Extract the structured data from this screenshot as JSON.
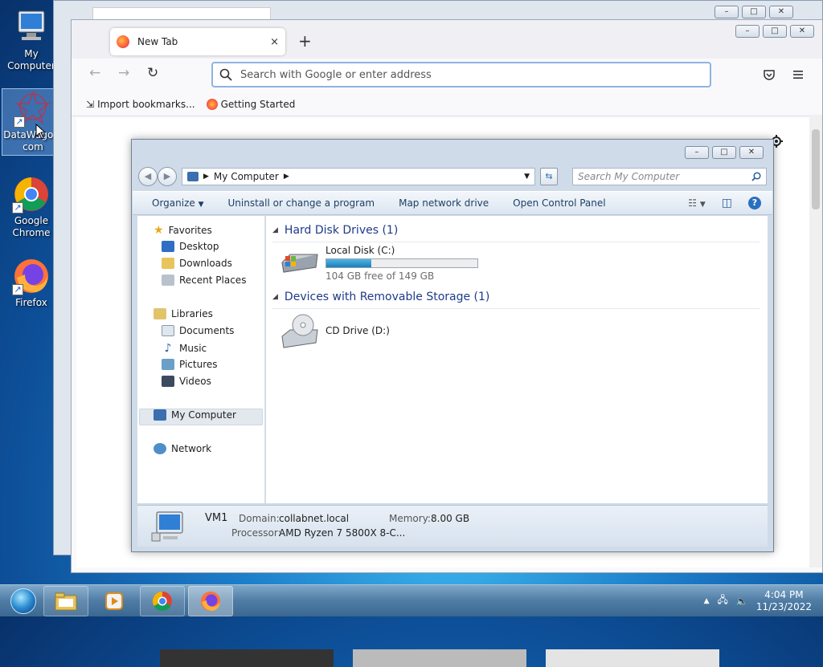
{
  "desktop": {
    "icons": [
      {
        "label": "My Computer"
      },
      {
        "label": "DataWagon.com"
      },
      {
        "label": "Google Chrome"
      },
      {
        "label": "Firefox"
      }
    ]
  },
  "firefox": {
    "tab_title": "New Tab",
    "tab_close": "×",
    "new_tab": "+",
    "url_placeholder": "Search with Google or enter address",
    "bookmarks": [
      "Import bookmarks...",
      "Getting Started"
    ]
  },
  "explorer": {
    "breadcrumb": "My Computer",
    "search_placeholder": "Search My Computer",
    "toolbar": {
      "organize": "Organize",
      "uninstall": "Uninstall or change a program",
      "map_drive": "Map network drive",
      "control_panel": "Open Control Panel"
    },
    "nav": {
      "favorites": "Favorites",
      "desktop": "Desktop",
      "downloads": "Downloads",
      "recent": "Recent Places",
      "libraries": "Libraries",
      "documents": "Documents",
      "music": "Music",
      "pictures": "Pictures",
      "videos": "Videos",
      "my_computer": "My Computer",
      "network": "Network"
    },
    "groups": {
      "hdd": "Hard Disk Drives (1)",
      "removable": "Devices with Removable Storage (1)"
    },
    "local_disk": {
      "name": "Local Disk (C:)",
      "free_text": "104 GB free of 149 GB",
      "used_fraction": 0.3
    },
    "cd_drive": {
      "name": "CD Drive (D:)"
    },
    "details": {
      "computer_name": "VM1",
      "domain_label": "Domain:",
      "domain_value": "collabnet.local",
      "memory_label": "Memory:",
      "memory_value": "8.00 GB",
      "processor_label": "Processor:",
      "processor_value": "AMD Ryzen 7 5800X 8-C..."
    }
  },
  "taskbar": {
    "time": "4:04 PM",
    "date": "11/23/2022"
  }
}
